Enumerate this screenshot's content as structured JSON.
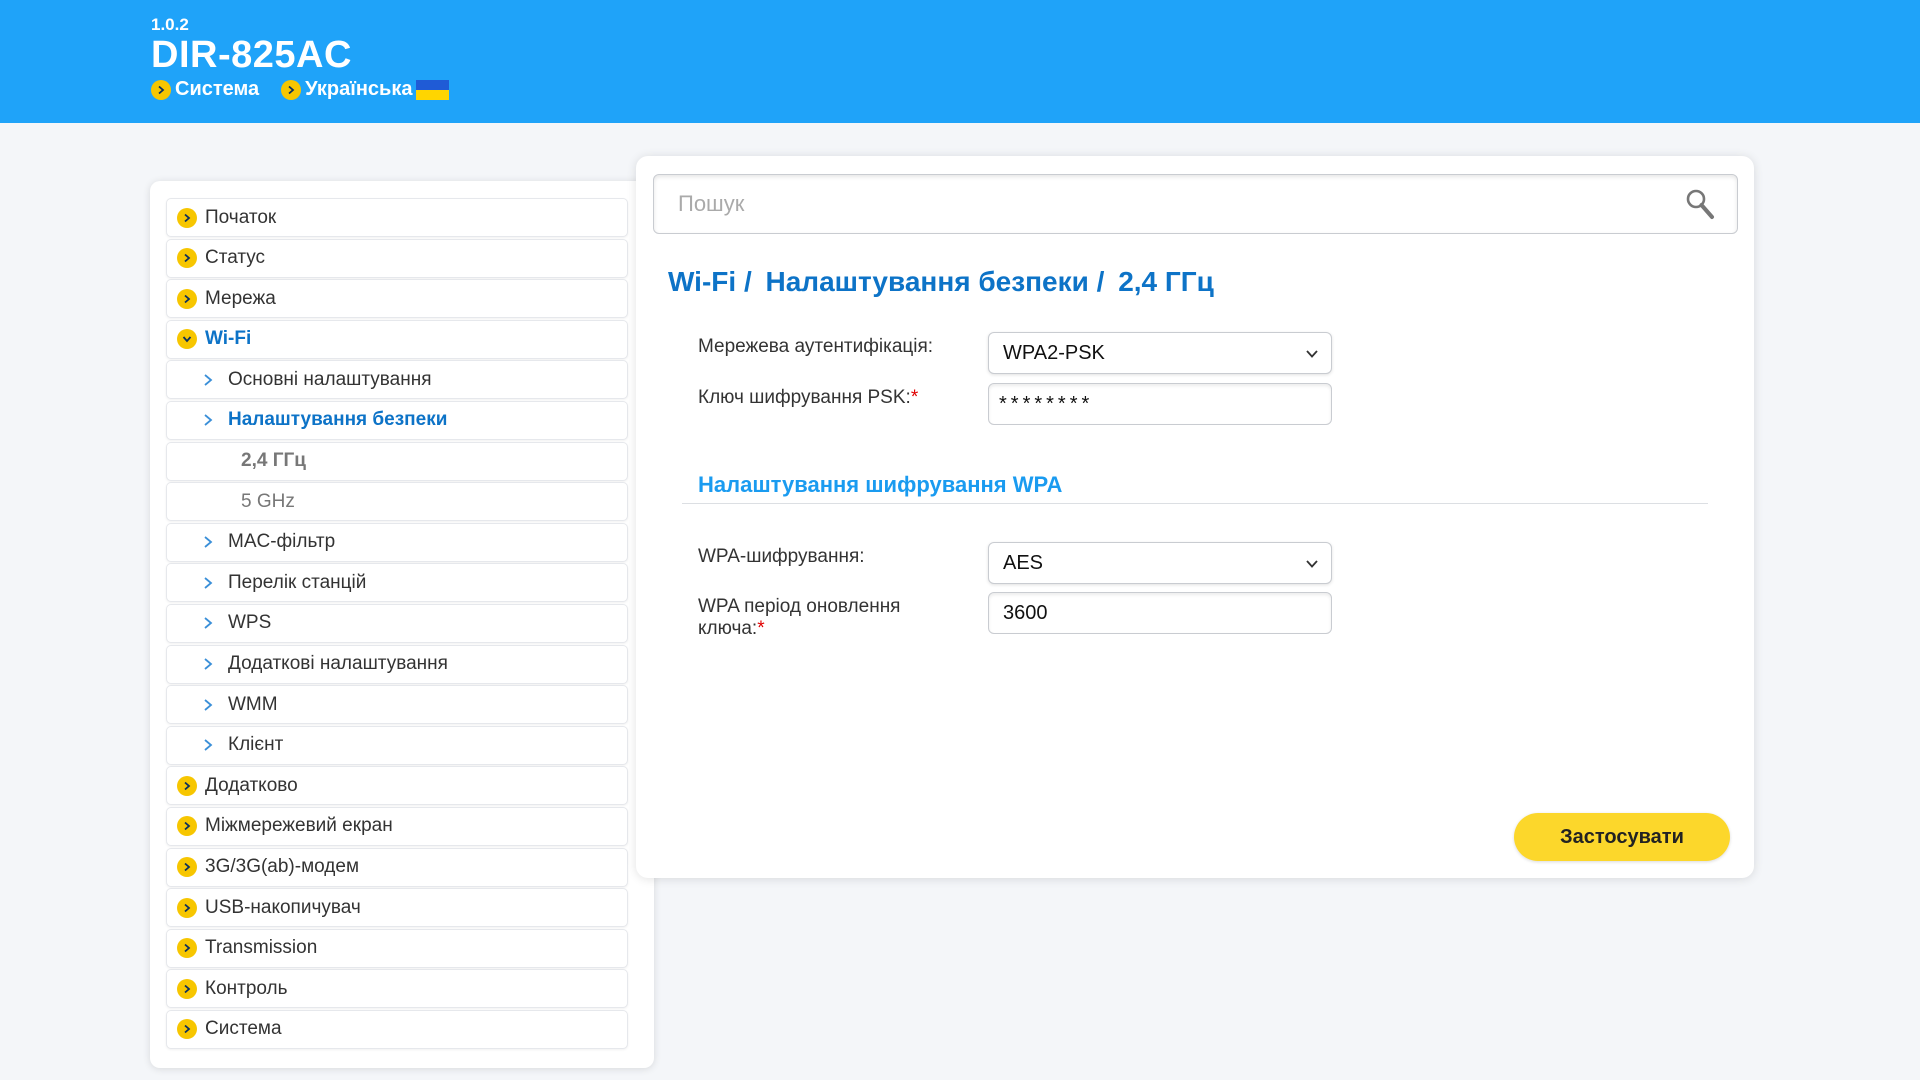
{
  "header": {
    "version": "1.0.2",
    "model": "DIR-825AC",
    "links": [
      {
        "label": "Система",
        "icon": "chevron-right-icon"
      },
      {
        "label": "Українська",
        "icon": "chevron-right-icon"
      }
    ],
    "flag": "ukraine-flag-icon",
    "bg_color": "#1fa3f9"
  },
  "sidebar": {
    "items": [
      {
        "label": "Початок",
        "level": 0
      },
      {
        "label": "Статус",
        "level": 0
      },
      {
        "label": "Мережа",
        "level": 0
      },
      {
        "label": "Wi-Fi",
        "level": 0,
        "expanded": true
      },
      {
        "label": "Основні налаштування",
        "level": 1
      },
      {
        "label": "Налаштування безпеки",
        "level": 1,
        "active": true
      },
      {
        "label": "2,4 ГГц",
        "level": 2,
        "active": true
      },
      {
        "label": "5 GHz",
        "level": 2
      },
      {
        "label": "MAC-фільтр",
        "level": 1
      },
      {
        "label": "Перелік станцій",
        "level": 1
      },
      {
        "label": "WPS",
        "level": 1
      },
      {
        "label": "Додаткові налаштування",
        "level": 1
      },
      {
        "label": "WMM",
        "level": 1
      },
      {
        "label": "Клієнт",
        "level": 1
      },
      {
        "label": "Додатково",
        "level": 0
      },
      {
        "label": "Міжмережевий екран",
        "level": 0
      },
      {
        "label": "3G/3G(ab)-модем",
        "level": 0
      },
      {
        "label": "USB-накопичувач",
        "level": 0
      },
      {
        "label": "Transmission",
        "level": 0
      },
      {
        "label": "Контроль",
        "level": 0
      },
      {
        "label": "Система",
        "level": 0
      }
    ]
  },
  "search": {
    "placeholder": "Пошук",
    "value": ""
  },
  "breadcrumb": {
    "parts": [
      "Wi-Fi /",
      "Налаштування безпеки /",
      "2,4 ГГц"
    ]
  },
  "form": {
    "auth_label": "Мережева аутентифікація:",
    "auth_value": "WPA2-PSK",
    "psk_label": "Ключ шифрування PSK:",
    "psk_required": "*",
    "psk_value": "********",
    "section_title": "Налаштування шифрування WPA",
    "wpa_enc_label": "WPA-шифрування:",
    "wpa_enc_value": "AES",
    "rekey_label_line1": "WPA період оновлення",
    "rekey_label_line2": "ключа:",
    "rekey_required": "*",
    "rekey_value": "3600"
  },
  "apply_label": "Застосувати",
  "colors": {
    "accent_blue": "#0d73c7",
    "section_blue": "#1a9bf0",
    "bullet_yellow": "#f7c600",
    "button_yellow": "#fcd72b"
  }
}
